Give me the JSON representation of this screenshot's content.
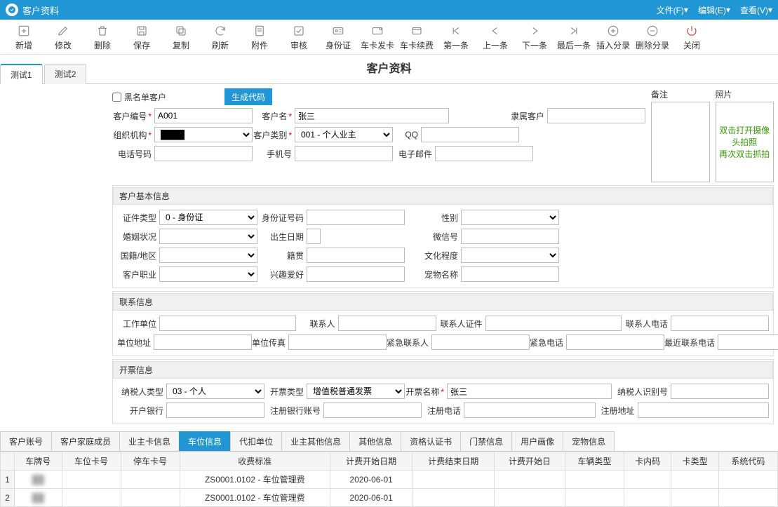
{
  "titlebar": {
    "title": "客户资料"
  },
  "menu": [
    {
      "label": "文件(F)"
    },
    {
      "label": "编辑(E)"
    },
    {
      "label": "查看(V)"
    }
  ],
  "toolbar": [
    {
      "label": "新增"
    },
    {
      "label": "修改"
    },
    {
      "label": "删除"
    },
    {
      "label": "保存"
    },
    {
      "label": "复制"
    },
    {
      "label": "刷新"
    },
    {
      "label": "附件"
    },
    {
      "label": "审核"
    },
    {
      "label": "身份证"
    },
    {
      "label": "车卡发卡"
    },
    {
      "label": "车卡续费"
    },
    {
      "label": "第一条"
    },
    {
      "label": "上一条"
    },
    {
      "label": "下一条"
    },
    {
      "label": "最后一条"
    },
    {
      "label": "插入分录"
    },
    {
      "label": "删除分录"
    },
    {
      "label": "关闭"
    }
  ],
  "page_title": "客户资料",
  "top_tabs": [
    {
      "label": "测试1"
    },
    {
      "label": "测试2"
    }
  ],
  "header": {
    "blacklist_label": "黑名单客户",
    "gen_code_btn": "生成代码",
    "customer_no_label": "客户编号",
    "customer_no": "A001",
    "customer_name_label": "客户名",
    "customer_name": "张三",
    "belong_label": "隶属客户",
    "org_label": "组织机构",
    "cust_type_label": "客户类别",
    "cust_type": "001 - 个人业主",
    "qq_label": "QQ",
    "remark_label": "备注",
    "photo_label": "照片",
    "photo_hint1": "双击打开摄像头拍照",
    "photo_hint2": "再次双击抓拍",
    "phone_label": "电话号码",
    "mobile_label": "手机号",
    "email_label": "电子邮件"
  },
  "basic": {
    "section": "客户基本信息",
    "id_type_label": "证件类型",
    "id_type": "0 - 身份证",
    "id_no_label": "身份证号码",
    "gender_label": "性别",
    "marriage_label": "婚姻状况",
    "birth_label": "出生日期",
    "wechat_label": "微信号",
    "nation_label": "国籍/地区",
    "origin_label": "籍贯",
    "edu_label": "文化程度",
    "job_label": "客户职业",
    "hobby_label": "兴趣爱好",
    "pet_label": "宠物名称"
  },
  "contact": {
    "section": "联系信息",
    "work_unit_label": "工作单位",
    "contact_label": "联系人",
    "contact_id_label": "联系人证件",
    "contact_phone_label": "联系人电话",
    "addr_label": "单位地址",
    "fax_label": "单位传真",
    "emergency_label": "紧急联系人",
    "emergency_phone_label": "紧急电话",
    "recent_phone_label": "最近联系电话"
  },
  "invoice": {
    "section": "开票信息",
    "taxpayer_type_label": "纳税人类型",
    "taxpayer_type": "03 - 个人",
    "invoice_type_label": "开票类型",
    "invoice_type": "增值税普通发票",
    "invoice_name_label": "开票名称",
    "invoice_name": "张三",
    "taxpayer_no_label": "纳税人识别号",
    "bank_label": "开户银行",
    "bank_acct_label": "注册银行账号",
    "reg_phone_label": "注册电话",
    "reg_addr_label": "注册地址"
  },
  "bottom_tabs": [
    {
      "label": "客户账号"
    },
    {
      "label": "客户家庭成员"
    },
    {
      "label": "业主卡信息"
    },
    {
      "label": "车位信息",
      "active": true
    },
    {
      "label": "代扣单位"
    },
    {
      "label": "业主其他信息"
    },
    {
      "label": "其他信息"
    },
    {
      "label": "资格认证书"
    },
    {
      "label": "门禁信息"
    },
    {
      "label": "用户画像"
    },
    {
      "label": "宠物信息"
    }
  ],
  "grid": {
    "headers": [
      "车牌号",
      "车位卡号",
      "停车卡号",
      "收费标准",
      "计费开始日期",
      "计费结束日期",
      "计费开始日",
      "车辆类型",
      "卡内码",
      "卡类型",
      "系统代码"
    ],
    "rows": [
      {
        "n": "1",
        "fee": "ZS0001.0102 - 车位管理费",
        "start": "2020-06-01"
      },
      {
        "n": "2",
        "fee": "ZS0001.0102 - 车位管理费",
        "start": "2020-06-01"
      }
    ]
  }
}
